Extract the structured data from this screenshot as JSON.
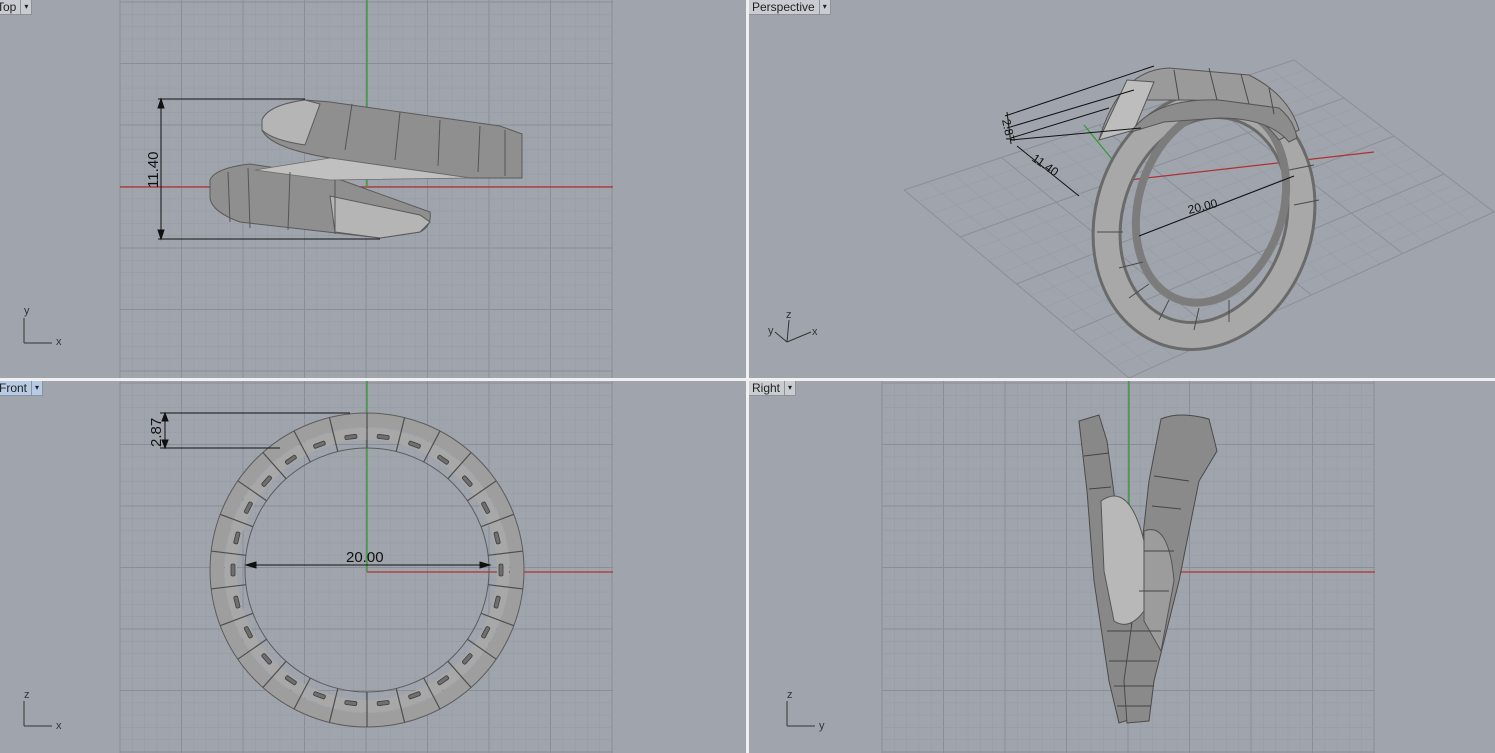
{
  "viewports": {
    "top": {
      "label": "Top",
      "active": false
    },
    "perspective": {
      "label": "Perspective",
      "active": false
    },
    "front": {
      "label": "Front",
      "active": true
    },
    "right": {
      "label": "Right",
      "active": false
    }
  },
  "menu_glyph": "▾",
  "dimensions": {
    "top_height": "11.40",
    "front_thickness": "2.87",
    "front_diameter": "20.00",
    "persp_thickness": "2.87",
    "persp_height": "11.40",
    "persp_diameter": "20.00"
  },
  "axes": {
    "top": {
      "vertical": "y",
      "horizontal": "x"
    },
    "perspective": {
      "a": "y",
      "b": "z",
      "c": "x"
    },
    "front": {
      "vertical": "z",
      "horizontal": "x"
    },
    "right": {
      "vertical": "z",
      "horizontal": "y"
    }
  },
  "colors": {
    "viewport_bg": "#a0a5ad",
    "grid_minor": "#979ca4",
    "grid_major": "#8a8f97",
    "axis_x": "#b03030",
    "axis_y": "#2f9a2f",
    "model": "#9a9a9a",
    "active_tab": "#b7cbe6"
  }
}
